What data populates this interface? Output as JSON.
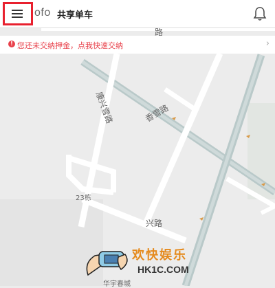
{
  "header": {
    "brand": "ofo",
    "title": "共享单车",
    "menu_icon": "hamburger-icon",
    "bell_icon": "bell-icon"
  },
  "notice": {
    "text": "您还未交纳押金，点我快速交纳",
    "chevron": "›"
  },
  "map": {
    "labels": {
      "road_a": "路",
      "road_xiangxue": "香雪路",
      "road_kangxue": "康兴雪路",
      "building_23": "23栋",
      "road_xing": "兴路",
      "bottom": "华宇春城"
    }
  },
  "watermark": {
    "text": "欢快娱乐",
    "url": "HK1C.COM"
  },
  "colors": {
    "highlight": "#e8202e",
    "notice": "#e8404a",
    "road_main": "#b9c9c9",
    "road_minor": "#ffffff",
    "map_bg": "#ececec"
  }
}
